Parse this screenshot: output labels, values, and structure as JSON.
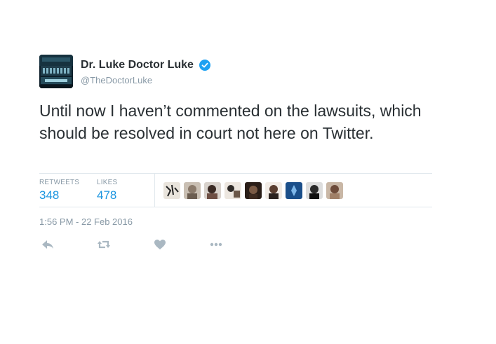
{
  "tweet": {
    "author": {
      "name": "Dr. Luke Doctor Luke",
      "username": "@TheDoctorLuke",
      "verified": true,
      "avatar_icon": "avatar-studio-console"
    },
    "text": "Until now I haven’t commented on the lawsuits, which should be resolved in court not here on Twitter.",
    "stats": {
      "retweets_label": "RETWEETS",
      "retweets_count": "348",
      "likes_label": "LIKES",
      "likes_count": "478"
    },
    "likers_count_shown": 9,
    "timestamp": "1:56 PM - 22 Feb 2016",
    "actions": [
      "reply-icon",
      "retweet-icon",
      "like-icon",
      "more-icon"
    ]
  },
  "colors": {
    "text": "#292f33",
    "muted": "#8899a6",
    "accent": "#1b95e0",
    "verified": "#1da1f2",
    "border": "#e1e8ed",
    "action_icon": "#aab8c2"
  }
}
